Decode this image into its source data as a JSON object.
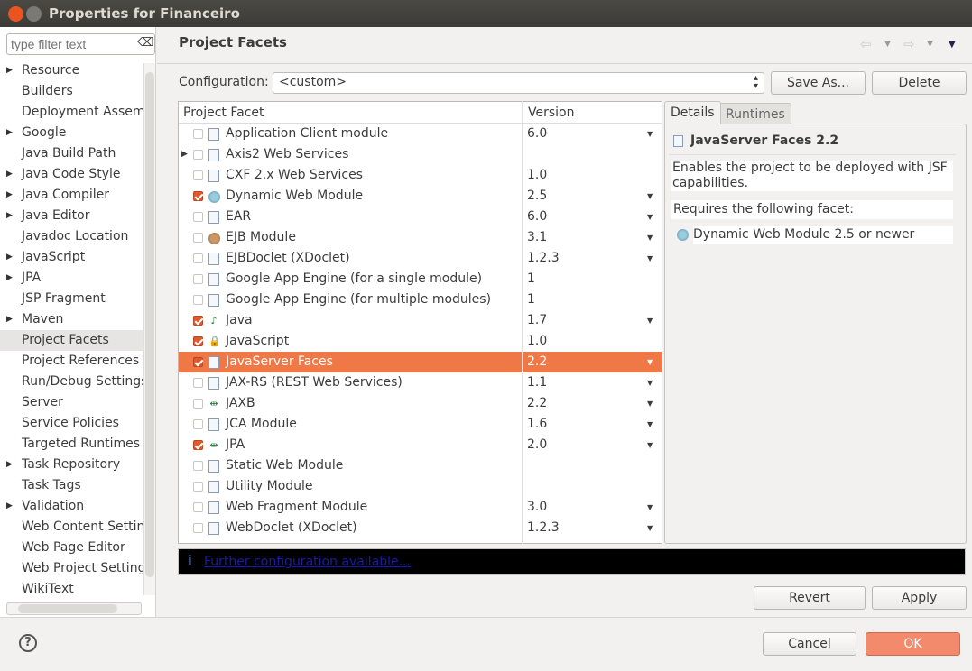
{
  "window": {
    "title": "Properties for Financeiro",
    "close_color": "#e95420"
  },
  "filter": {
    "placeholder": "type filter text"
  },
  "sidebar": {
    "items": [
      {
        "label": "Resource",
        "expandable": true
      },
      {
        "label": "Builders"
      },
      {
        "label": "Deployment Assembl"
      },
      {
        "label": "Google",
        "expandable": true
      },
      {
        "label": "Java Build Path"
      },
      {
        "label": "Java Code Style",
        "expandable": true
      },
      {
        "label": "Java Compiler",
        "expandable": true
      },
      {
        "label": "Java Editor",
        "expandable": true
      },
      {
        "label": "Javadoc Location"
      },
      {
        "label": "JavaScript",
        "expandable": true
      },
      {
        "label": "JPA",
        "expandable": true
      },
      {
        "label": "JSP Fragment"
      },
      {
        "label": "Maven",
        "expandable": true
      },
      {
        "label": "Project Facets",
        "selected": true
      },
      {
        "label": "Project References"
      },
      {
        "label": "Run/Debug Settings"
      },
      {
        "label": "Server"
      },
      {
        "label": "Service Policies"
      },
      {
        "label": "Targeted Runtimes"
      },
      {
        "label": "Task Repository",
        "expandable": true
      },
      {
        "label": "Task Tags"
      },
      {
        "label": "Validation",
        "expandable": true
      },
      {
        "label": "Web Content Settings"
      },
      {
        "label": "Web Page Editor"
      },
      {
        "label": "Web Project Settings"
      },
      {
        "label": "WikiText"
      }
    ]
  },
  "page": {
    "title": "Project Facets",
    "configuration_label": "Configuration:",
    "configuration_value": "<custom>",
    "save_as": "Save As...",
    "delete": "Delete"
  },
  "table": {
    "col_facet": "Project Facet",
    "col_version": "Version",
    "rows": [
      {
        "name": "Application Client module",
        "checked": false,
        "icon": "doc",
        "version": "6.0",
        "dropdown": true
      },
      {
        "name": "Axis2 Web Services",
        "checked": false,
        "icon": "doc",
        "version": "",
        "dropdown": false,
        "expandable": true
      },
      {
        "name": "CXF 2.x Web Services",
        "checked": false,
        "icon": "doc",
        "version": "1.0",
        "dropdown": false
      },
      {
        "name": "Dynamic Web Module",
        "checked": true,
        "icon": "globe",
        "version": "2.5",
        "dropdown": true
      },
      {
        "name": "EAR",
        "checked": false,
        "icon": "doc",
        "version": "6.0",
        "dropdown": true
      },
      {
        "name": "EJB Module",
        "checked": false,
        "icon": "bean",
        "version": "3.1",
        "dropdown": true
      },
      {
        "name": "EJBDoclet (XDoclet)",
        "checked": false,
        "icon": "doc",
        "version": "1.2.3",
        "dropdown": true
      },
      {
        "name": "Google App Engine (for a single module)",
        "checked": false,
        "icon": "doc",
        "version": "1",
        "dropdown": false
      },
      {
        "name": "Google App Engine (for multiple modules)",
        "checked": false,
        "icon": "doc",
        "version": "1",
        "dropdown": false
      },
      {
        "name": "Java",
        "checked": true,
        "icon": "java",
        "version": "1.7",
        "dropdown": true
      },
      {
        "name": "JavaScript",
        "checked": true,
        "icon": "js",
        "version": "1.0",
        "dropdown": false
      },
      {
        "name": "JavaServer Faces",
        "checked": true,
        "icon": "doc",
        "version": "2.2",
        "dropdown": true,
        "selected": true
      },
      {
        "name": "JAX-RS (REST Web Services)",
        "checked": false,
        "icon": "doc",
        "version": "1.1",
        "dropdown": true
      },
      {
        "name": "JAXB",
        "checked": false,
        "icon": "arrows",
        "version": "2.2",
        "dropdown": true
      },
      {
        "name": "JCA Module",
        "checked": false,
        "icon": "doc",
        "version": "1.6",
        "dropdown": true
      },
      {
        "name": "JPA",
        "checked": true,
        "icon": "arrows",
        "version": "2.0",
        "dropdown": true
      },
      {
        "name": "Static Web Module",
        "checked": false,
        "icon": "doc",
        "version": "",
        "dropdown": false
      },
      {
        "name": "Utility Module",
        "checked": false,
        "icon": "doc",
        "version": "",
        "dropdown": false
      },
      {
        "name": "Web Fragment Module",
        "checked": false,
        "icon": "doc",
        "version": "3.0",
        "dropdown": true
      },
      {
        "name": "WebDoclet (XDoclet)",
        "checked": false,
        "icon": "doc",
        "version": "1.2.3",
        "dropdown": true
      }
    ]
  },
  "details": {
    "tabs": [
      "Details",
      "Runtimes"
    ],
    "title": "JavaServer Faces 2.2",
    "description": "Enables the project to be deployed with JSF capabilities.",
    "requires_label": "Requires the following facet:",
    "requirement": "Dynamic Web Module 2.5 or newer"
  },
  "info": {
    "link": "Further configuration available..."
  },
  "buttons": {
    "revert": "Revert",
    "apply": "Apply",
    "cancel": "Cancel",
    "ok": "OK"
  },
  "colors": {
    "selection": "#f07746",
    "ok_button": "#f28a6b"
  }
}
